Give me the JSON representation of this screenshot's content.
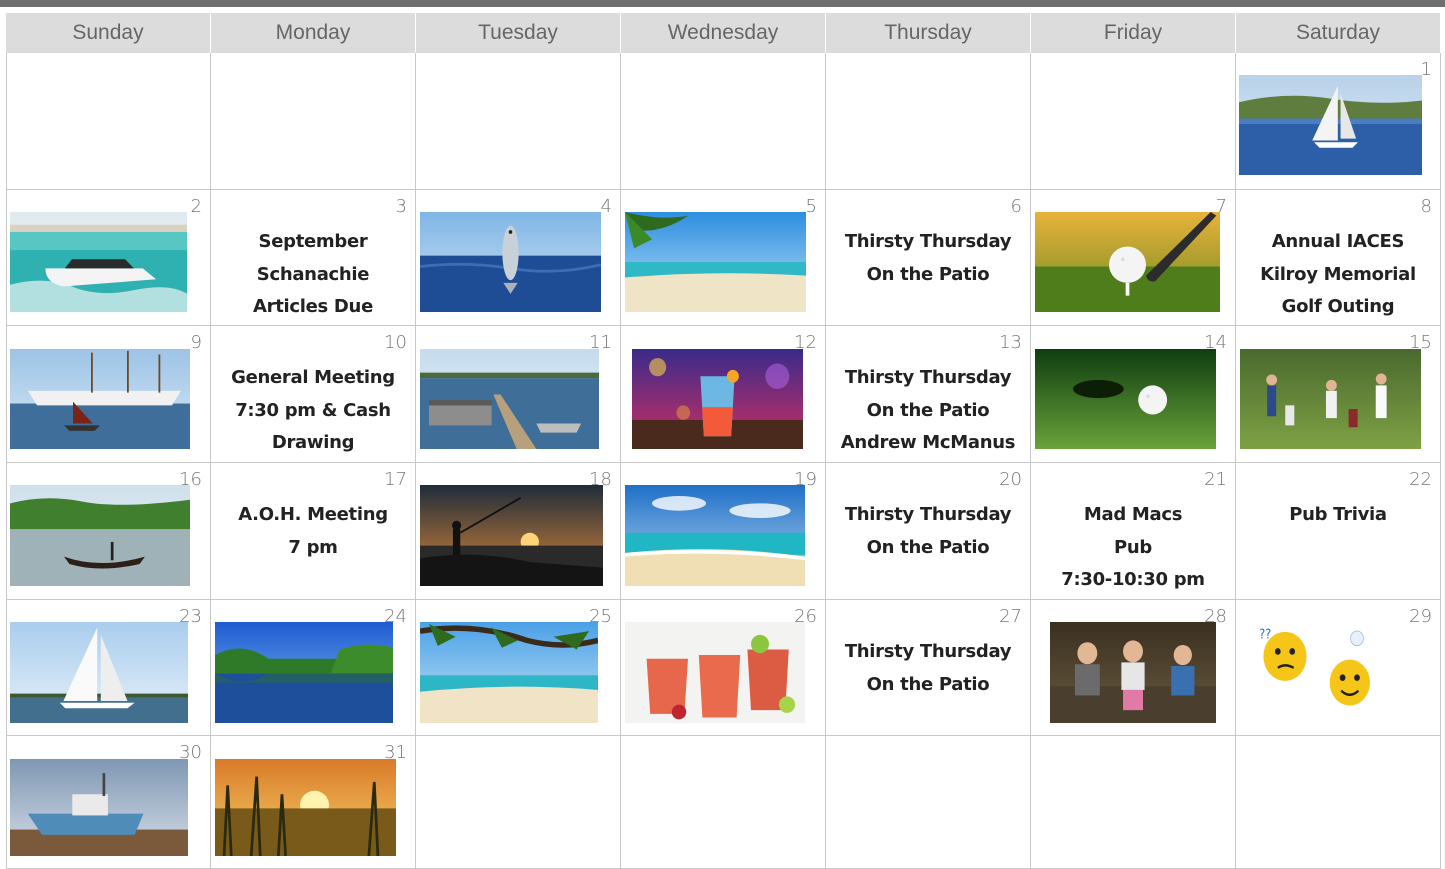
{
  "days_of_week": [
    "Sunday",
    "Monday",
    "Tuesday",
    "Wednesday",
    "Thursday",
    "Friday",
    "Saturday"
  ],
  "colors": {
    "header_bg": "#dcdcdc",
    "top_bar": "#6f6f6f",
    "grid_line": "#c8c8c8"
  },
  "weeks": [
    [
      null,
      null,
      null,
      null,
      null,
      null,
      {
        "day": "1",
        "image": "sailboat-on-lake"
      }
    ],
    [
      {
        "day": "2",
        "image": "speedboat"
      },
      {
        "day": "3",
        "events": [
          "September",
          "Schanachie",
          "Articles Due"
        ]
      },
      {
        "day": "4",
        "image": "jumping-fish"
      },
      {
        "day": "5",
        "image": "tropical-beach"
      },
      {
        "day": "6",
        "events": [
          "Thirsty Thursday",
          "On the Patio"
        ]
      },
      {
        "day": "7",
        "image": "golf-ball-on-tee"
      },
      {
        "day": "8",
        "events": [
          "Annual IACES",
          "Kilroy Memorial",
          "Golf Outing"
        ]
      }
    ],
    [
      {
        "day": "9",
        "image": "tall-ships"
      },
      {
        "day": "10",
        "events": [
          "General Meeting",
          "7:30 pm & Cash",
          "Drawing"
        ]
      },
      {
        "day": "11",
        "image": "pontoon-boat-dock"
      },
      {
        "day": "12",
        "image": "cocktail"
      },
      {
        "day": "13",
        "events": [
          "Thirsty Thursday",
          "On the Patio",
          "Andrew McManus"
        ]
      },
      {
        "day": "14",
        "image": "golf-ball-near-hole"
      },
      {
        "day": "15",
        "image": "golfers"
      }
    ],
    [
      {
        "day": "16",
        "image": "canoe-on-river"
      },
      {
        "day": "17",
        "events": [
          "A.O.H. Meeting",
          "7 pm"
        ]
      },
      {
        "day": "18",
        "image": "fisherman-sunset"
      },
      {
        "day": "19",
        "image": "beach-waves"
      },
      {
        "day": "20",
        "events": [
          "Thirsty Thursday",
          "On the Patio"
        ]
      },
      {
        "day": "21",
        "events": [
          "Mad Macs",
          "Pub",
          "7:30-10:30 pm"
        ]
      },
      {
        "day": "22",
        "events": [
          "Pub Trivia"
        ]
      }
    ],
    [
      {
        "day": "23",
        "image": "sailboat"
      },
      {
        "day": "24",
        "image": "blue-lake"
      },
      {
        "day": "25",
        "image": "beach-tree"
      },
      {
        "day": "26",
        "image": "red-drinks"
      },
      {
        "day": "27",
        "events": [
          "Thirsty Thursday",
          "On the Patio"
        ]
      },
      {
        "day": "28",
        "image": "children-accordions"
      },
      {
        "day": "29",
        "image": "thinking-smileys"
      }
    ],
    [
      {
        "day": "30",
        "image": "fishing-boat-on-shore"
      },
      {
        "day": "31",
        "image": "marsh-sunset"
      },
      null,
      null,
      null,
      null,
      null
    ]
  ]
}
